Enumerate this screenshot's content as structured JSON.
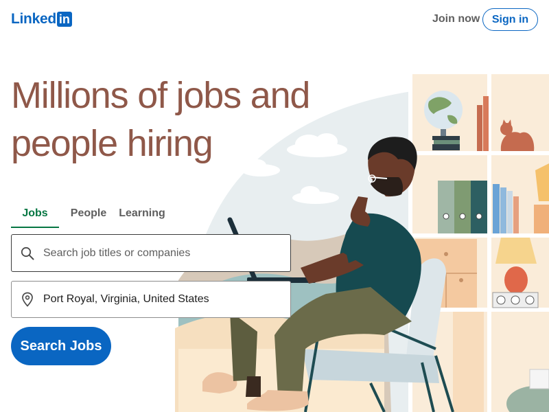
{
  "header": {
    "logo_text": "Linked",
    "logo_box_text": "in",
    "join_now_label": "Join now",
    "sign_in_label": "Sign in"
  },
  "hero": {
    "headline_line1": "Millions of jobs and",
    "headline_line2": "people hiring"
  },
  "tabs": [
    {
      "label": "Jobs",
      "active": true
    },
    {
      "label": "People",
      "active": false
    },
    {
      "label": "Learning",
      "active": false
    }
  ],
  "search": {
    "job_placeholder": "Search job titles or companies",
    "job_value": "",
    "location_value": "Port Royal, Virginia, United States",
    "submit_label": "Search Jobs"
  },
  "colors": {
    "brand_blue": "#0a66c2",
    "headline_brown": "#8f5849",
    "active_tab_green": "#057642",
    "muted_text": "#5e5e5e"
  },
  "icons": {
    "job_field_icon": "search-icon",
    "location_field_icon": "location-pin-icon"
  }
}
